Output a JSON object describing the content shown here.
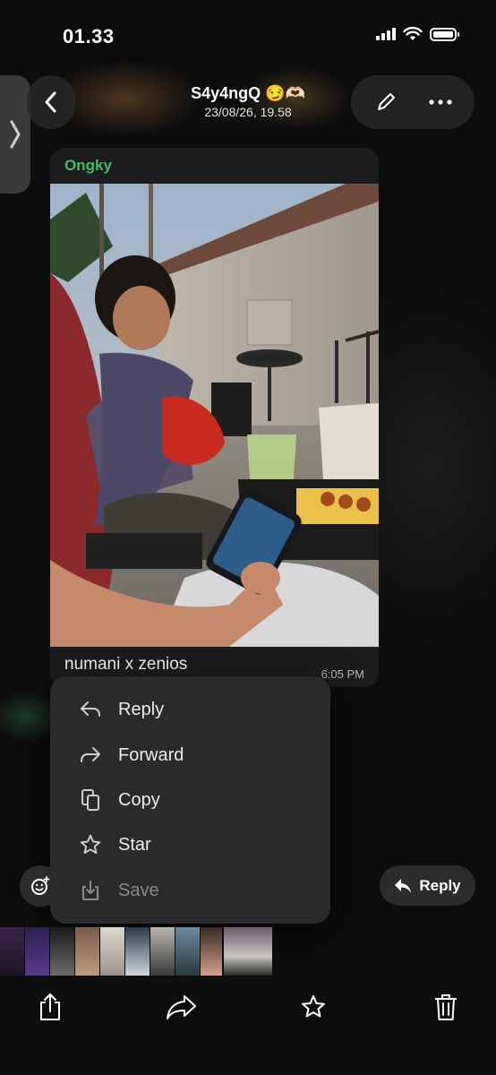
{
  "status_bar": {
    "time": "01.33"
  },
  "header": {
    "title": "S4y4ngQ 😏🫶🏻",
    "subtitle": "23/08/26, 19.58",
    "icons": [
      "back-chevron-icon",
      "pencil-icon",
      "more-icon"
    ]
  },
  "message": {
    "sender": "Ongky",
    "caption": "numani x zenios",
    "time": "6:05 PM"
  },
  "context_menu": {
    "items": [
      {
        "label": "Reply",
        "icon": "reply-icon"
      },
      {
        "label": "Forward",
        "icon": "forward-icon"
      },
      {
        "label": "Copy",
        "icon": "copy-icon"
      },
      {
        "label": "Star",
        "icon": "star-icon"
      },
      {
        "label": "Save",
        "icon": "save-icon"
      }
    ]
  },
  "reply_button": {
    "label": "Reply"
  },
  "toolbar": {
    "icons": [
      "share-icon",
      "forward-icon",
      "star-icon",
      "trash-icon"
    ]
  },
  "colors": {
    "sender": "#3ebf64",
    "menu_bg": "#2a2a2c",
    "bubble_bg": "#1c1c1e"
  }
}
